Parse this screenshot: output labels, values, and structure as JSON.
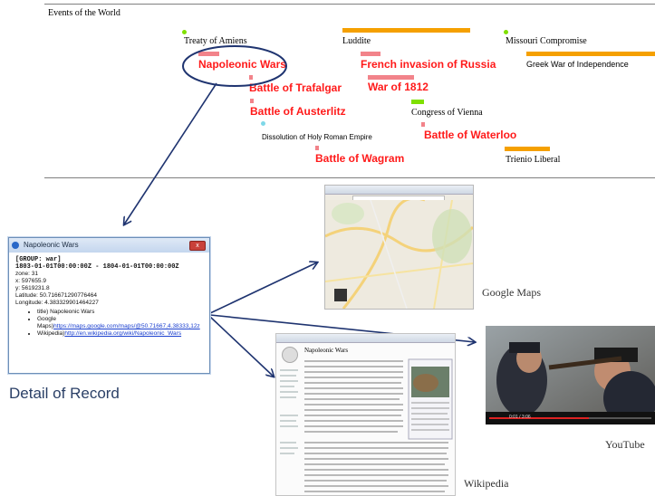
{
  "header": {
    "title": "Events of the World"
  },
  "timeline": {
    "events_black": [
      {
        "key": "treaty",
        "label": "Treaty of Amiens"
      },
      {
        "key": "luddite",
        "label": "Luddite"
      },
      {
        "key": "missouri",
        "label": "Missouri Compromise"
      },
      {
        "key": "greek",
        "label": "Greek War of Independence"
      },
      {
        "key": "congress",
        "label": "Congress of Vienna"
      },
      {
        "key": "hre",
        "label": "Dissolution of Holy Roman Empire"
      },
      {
        "key": "trienio",
        "label": "Trienio Liberal"
      }
    ],
    "events_red": [
      {
        "key": "napoleonic",
        "label": "Napoleonic Wars"
      },
      {
        "key": "russia",
        "label": "French invasion of Russia"
      },
      {
        "key": "trafalgar",
        "label": "Battle of Trafalgar"
      },
      {
        "key": "war1812",
        "label": "War of 1812"
      },
      {
        "key": "austerlitz",
        "label": "Battle of Austerlitz"
      },
      {
        "key": "waterloo",
        "label": "Battle of Waterloo"
      },
      {
        "key": "wagram",
        "label": "Battle of Wagram"
      }
    ],
    "colors": {
      "orange": "#f5a000",
      "green": "#7fe000",
      "pink": "#f2838a",
      "cyan": "#7fd8e8",
      "red_text": "#ff1a1a",
      "highlight_ellipse": "#1f3470"
    }
  },
  "detail_window": {
    "title": "Napoleonic Wars",
    "close_label": "x",
    "group": "[GROUP: war]",
    "time_range": "1803-01-01T00:00:00Z - 1804-01-01T00:00:00Z",
    "fields": [
      "zone: 31",
      "x: 597655.9",
      "y: 5619231.8",
      "Latitude: 50.716671290776464",
      "Longitude: 4.383329901464227"
    ],
    "links": {
      "title_line": "title) Napoleonic Wars",
      "maps_label": "Google Maps)",
      "maps_url": "https://maps.google.com/maps/@50.71667,4.38333,12z",
      "wiki_label": "Wikipedia)",
      "wiki_url": "http://en.wikipedia.org/wiki/Napoleonic_Wars"
    }
  },
  "captions": {
    "detail": "Detail of Record",
    "maps": "Google Maps",
    "youtube": "YouTube",
    "wikipedia": "Wikipedia"
  },
  "wikipedia_page": {
    "heading": "Napoleonic Wars"
  },
  "youtube_player": {
    "time": "0:01 / 3:06"
  }
}
